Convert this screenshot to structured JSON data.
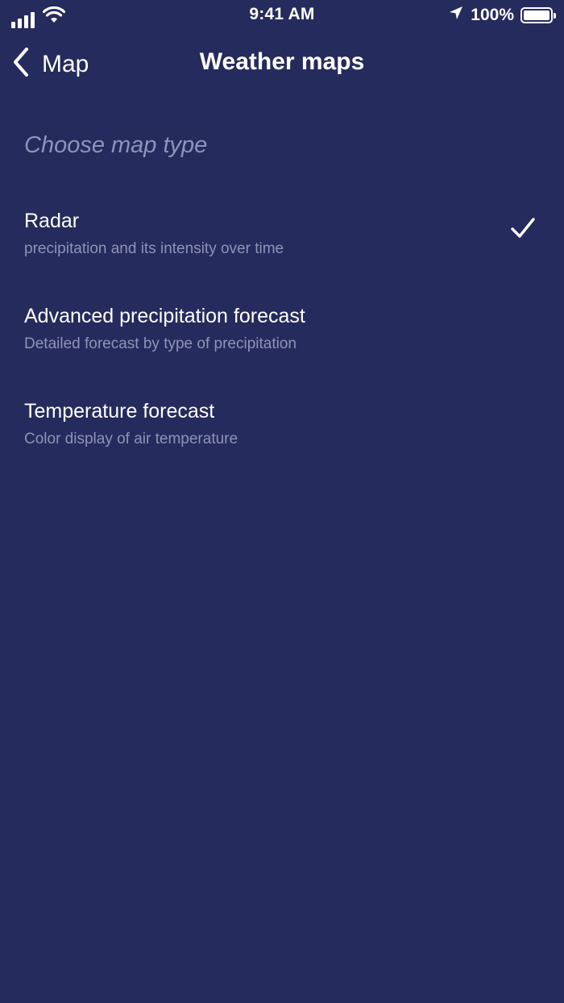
{
  "status_bar": {
    "time": "9:41 AM",
    "battery_percent": "100%",
    "battery_level": 1.0
  },
  "nav": {
    "back_label": "Map",
    "title": "Weather maps"
  },
  "section": {
    "header": "Choose map type"
  },
  "options": [
    {
      "title": "Radar",
      "subtitle": "precipitation and its intensity over time",
      "selected": true
    },
    {
      "title": "Advanced precipitation forecast",
      "subtitle": "Detailed forecast by type of precipitation",
      "selected": false
    },
    {
      "title": "Temperature forecast",
      "subtitle": "Color display of air temperature",
      "selected": false
    }
  ],
  "colors": {
    "background": "#262b5d",
    "text_primary": "#ffffff",
    "text_secondary": "#8e93b8"
  },
  "icons": {
    "signal": "cellular-signal-icon",
    "wifi": "wifi-icon",
    "location": "location-arrow-icon",
    "battery": "battery-icon",
    "back": "chevron-left-icon",
    "selected": "checkmark-icon"
  }
}
